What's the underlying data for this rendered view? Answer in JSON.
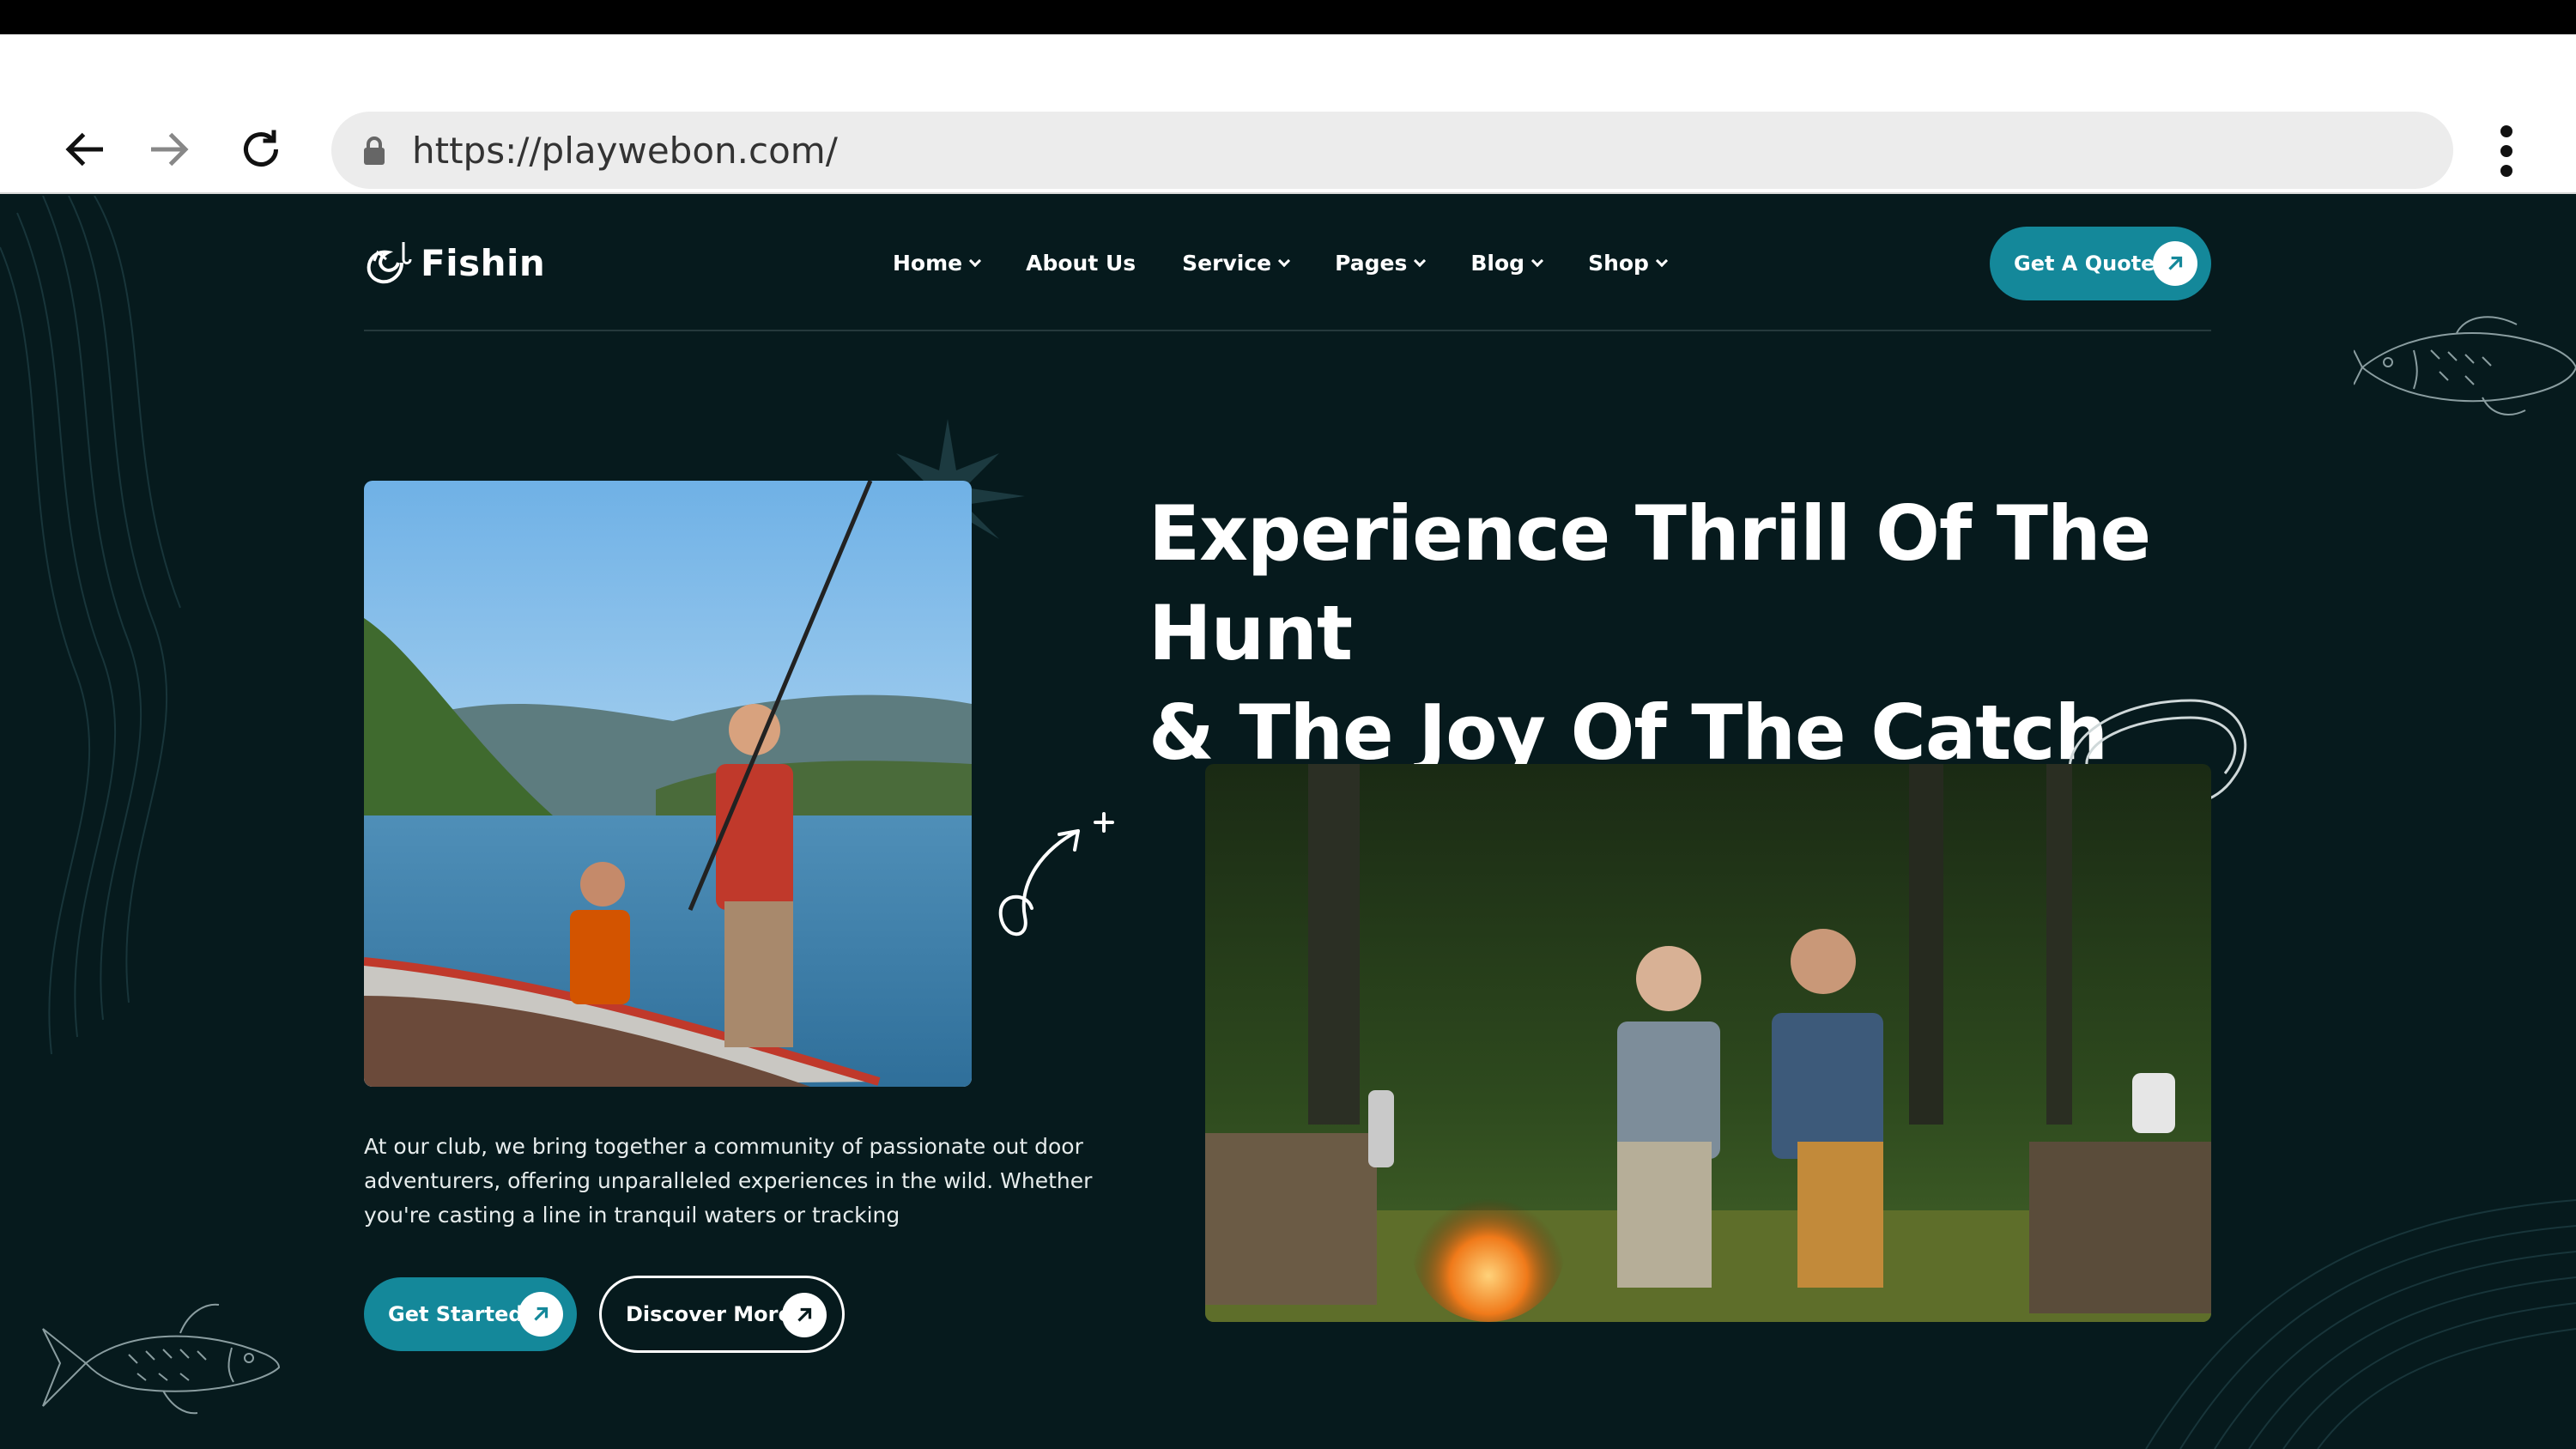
{
  "browser": {
    "url": "https://playwebon.com/",
    "back_icon": "arrow-left-icon",
    "forward_icon": "arrow-right-icon",
    "reload_icon": "reload-icon",
    "menu_icon": "kebab-menu-icon",
    "lock_icon": "lock-icon"
  },
  "site": {
    "logo_text": "Fishin",
    "nav": [
      {
        "label": "Home",
        "has_dropdown": true
      },
      {
        "label": "About Us",
        "has_dropdown": false
      },
      {
        "label": "Service",
        "has_dropdown": true
      },
      {
        "label": "Pages",
        "has_dropdown": true
      },
      {
        "label": "Blog",
        "has_dropdown": true
      },
      {
        "label": "Shop",
        "has_dropdown": true
      }
    ],
    "quote_button": "Get A Quote",
    "hero": {
      "title_line1": "Experience Thrill Of The Hunt",
      "title_line2": "& The Joy Of The Catch",
      "description": "At our club, we bring together a community of passionate out door adventurers, offering unparalleled experiences in the wild. Whether you're casting a line in tranquil waters or tracking",
      "primary_button": "Get Started",
      "secondary_button": "Discover More"
    }
  },
  "colors": {
    "background": "#061a1d",
    "accent": "#14889a",
    "text": "#ffffff"
  }
}
